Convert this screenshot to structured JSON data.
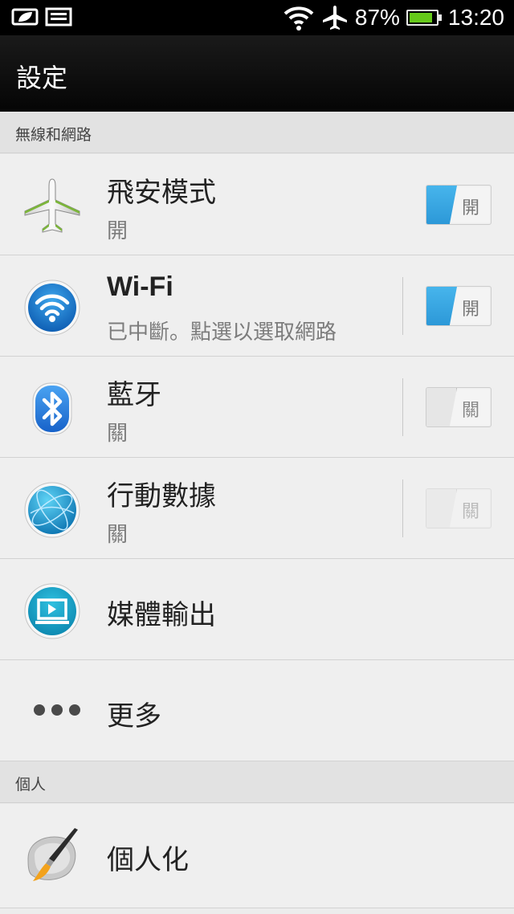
{
  "status_bar": {
    "battery_percent": "87%",
    "battery_level": 0.87,
    "time": "13:20",
    "icons": [
      "eco-leaf-icon",
      "image-icon",
      "wifi-signal-icon",
      "airplane-icon",
      "battery-icon"
    ]
  },
  "header": {
    "title": "設定"
  },
  "sections": {
    "wireless": "無線和網路",
    "personal": "個人"
  },
  "rows": {
    "airplane": {
      "title": "飛安模式",
      "subtitle": "開",
      "toggle": "開",
      "state": "on"
    },
    "wifi": {
      "title": "Wi-Fi",
      "subtitle": "已中斷。點選以選取網路",
      "toggle": "開",
      "state": "on"
    },
    "bluetooth": {
      "title": "藍牙",
      "subtitle": "關",
      "toggle": "關",
      "state": "off"
    },
    "mobile_data": {
      "title": "行動數據",
      "subtitle": "關",
      "toggle": "關",
      "state": "disabled"
    },
    "media_output": {
      "title": "媒體輸出"
    },
    "more": {
      "title": "更多"
    },
    "personalize": {
      "title": "個人化"
    }
  },
  "colors": {
    "accent_blue": "#2b97d7",
    "battery_green": "#65c91a",
    "background": "#ececec"
  }
}
